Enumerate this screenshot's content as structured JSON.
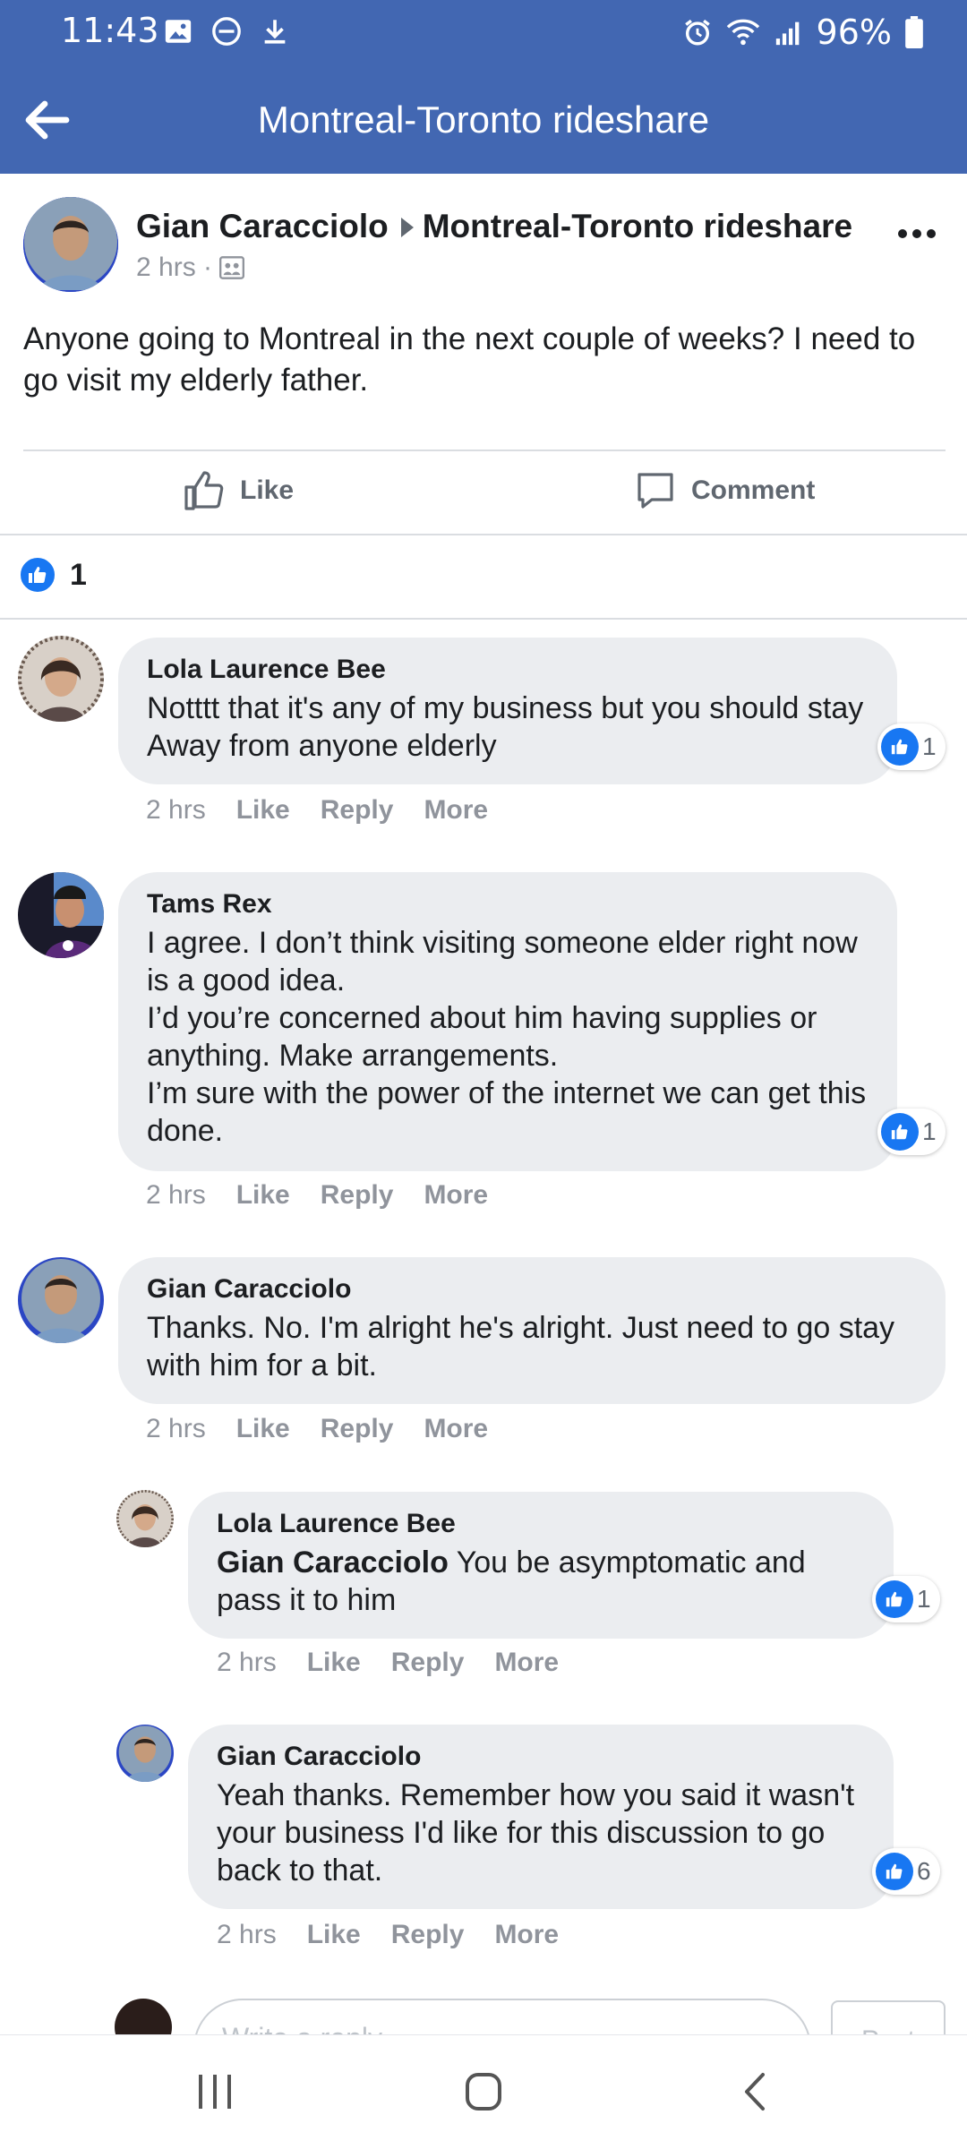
{
  "status_bar": {
    "time": "11:43",
    "battery": "96%"
  },
  "header": {
    "title": "Montreal-Toronto rideshare"
  },
  "post": {
    "author": "Gian Caracciolo",
    "group": "Montreal-Toronto rideshare",
    "time": "2 hrs ·",
    "text": "Anyone going to Montreal in the next couple of weeks? I need to go visit my elderly father.",
    "like_label": "Like",
    "comment_label": "Comment",
    "reaction_count": "1"
  },
  "comments": [
    {
      "name": "Lola Laurence Bee",
      "text": "Notttt that it's any of my business but you should stay Away from anyone elderly",
      "reactions": "1",
      "time": "2 hrs",
      "like": "Like",
      "reply": "Reply",
      "more": "More"
    },
    {
      "name": "Tams Rex",
      "text": "I agree. I don’t think visiting someone elder right now is a good idea.\nI’d you’re concerned about him having supplies or anything. Make arrangements.\nI’m sure with the power of the internet we can get this done.",
      "reactions": "1",
      "time": "2 hrs",
      "like": "Like",
      "reply": "Reply",
      "more": "More"
    },
    {
      "name": "Gian Caracciolo",
      "text": "Thanks. No. I'm alright he's alright. Just need to go stay with him for a bit.",
      "time": "2 hrs",
      "like": "Like",
      "reply": "Reply",
      "more": "More"
    }
  ],
  "replies": [
    {
      "name": "Lola Laurence Bee",
      "mention": "Gian Caracciolo",
      "text": " You be asymptomatic and pass it to him",
      "reactions": "1",
      "time": "2 hrs",
      "like": "Like",
      "reply": "Reply",
      "more": "More"
    },
    {
      "name": "Gian Caracciolo",
      "text": "Yeah thanks. Remember how you said it wasn't your business I'd like for this discussion to go back to that.",
      "reactions": "6",
      "time": "2 hrs",
      "like": "Like",
      "reply": "Reply",
      "more": "More"
    }
  ],
  "write_comment": {
    "placeholder": "Write a reply...",
    "post_label": "Post"
  },
  "colors": {
    "brand": "#4267b2",
    "like_blue": "#1877f2",
    "bubble": "#ebedf0",
    "muted": "#90949c"
  }
}
